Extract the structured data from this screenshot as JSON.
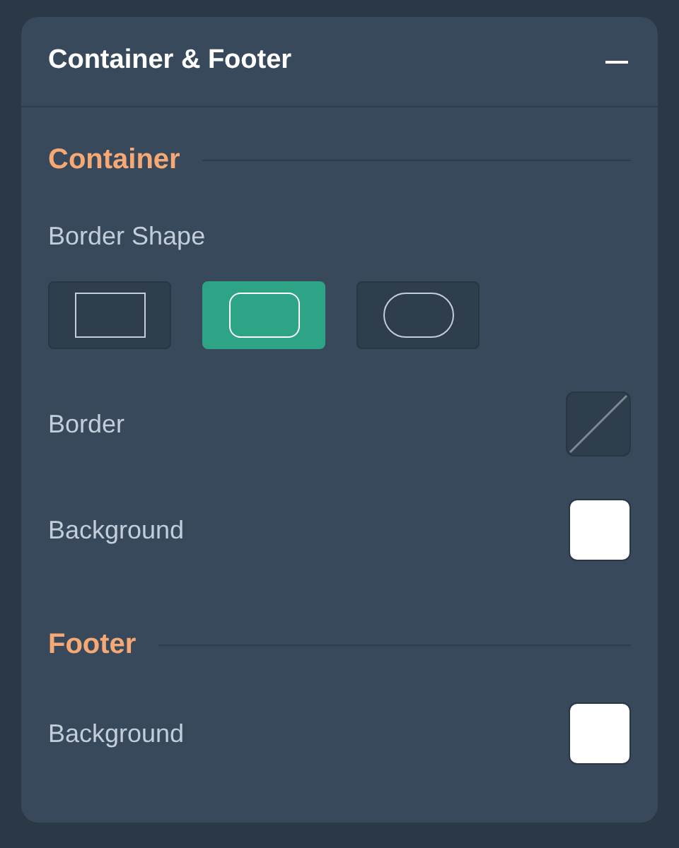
{
  "panel": {
    "title": "Container & Footer",
    "expanded": true
  },
  "sections": [
    {
      "title": "Container",
      "items": [
        {
          "kind": "shapes",
          "label": "Border Shape",
          "options": [
            {
              "kind": "square",
              "selected": false
            },
            {
              "kind": "rounded",
              "selected": true
            },
            {
              "kind": "pill",
              "selected": false
            }
          ]
        },
        {
          "kind": "color",
          "label": "Border"
        },
        {
          "kind": "color",
          "label": "Background",
          "color": "#ffffff"
        }
      ]
    },
    {
      "title": "Footer",
      "items": [
        {
          "kind": "color",
          "label": "Background",
          "color": "#ffffff"
        }
      ]
    }
  ]
}
